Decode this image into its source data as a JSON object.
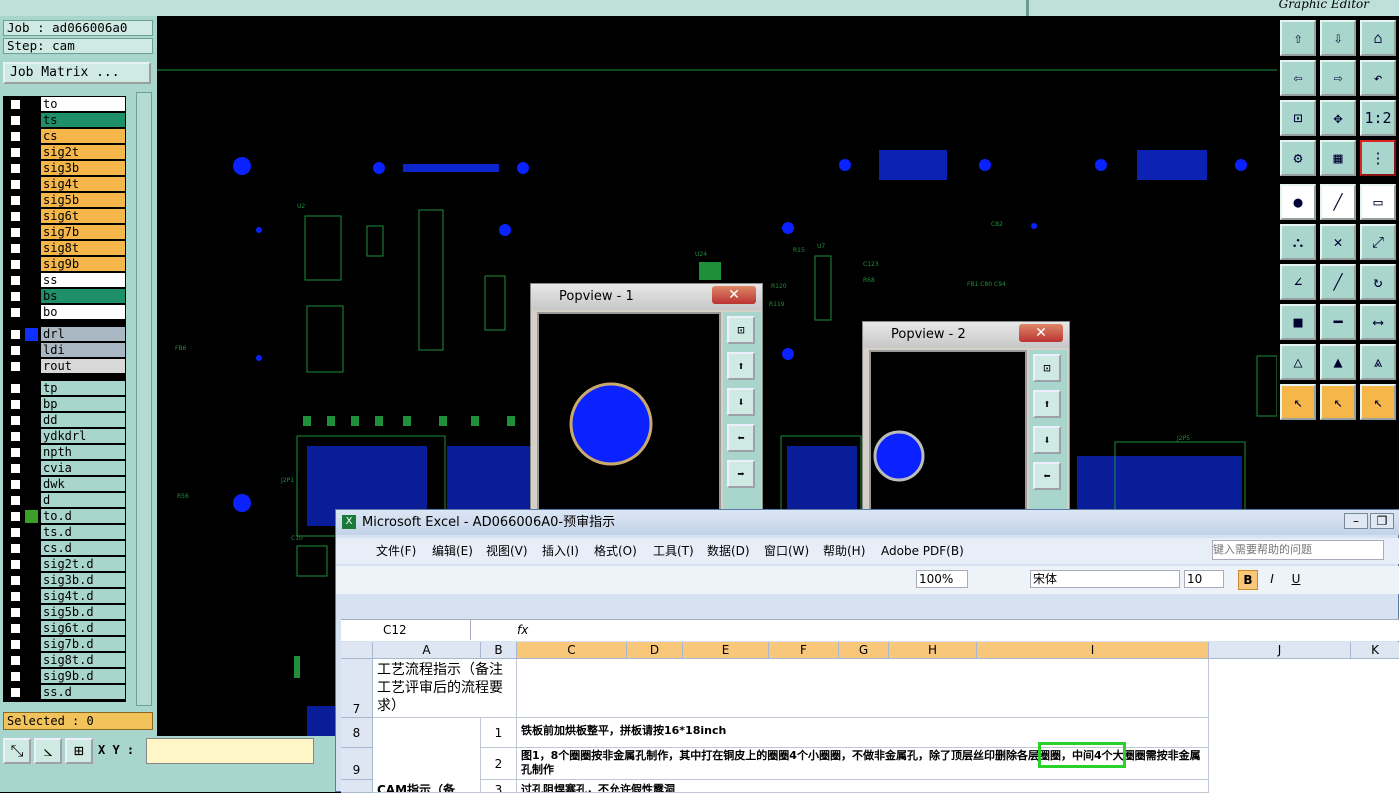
{
  "app": {
    "title": "Graphic Editor"
  },
  "job": {
    "name": "Job : ad066006a0",
    "step": "Step: cam",
    "matrix_label": "Job Matrix ..."
  },
  "layers": [
    {
      "name": "to",
      "color": "#ffffff"
    },
    {
      "name": "ts",
      "color": "#1f8f6a"
    },
    {
      "name": "cs",
      "color": "#f5b74a"
    },
    {
      "name": "sig2t",
      "color": "#f5b74a"
    },
    {
      "name": "sig3b",
      "color": "#f5b74a"
    },
    {
      "name": "sig4t",
      "color": "#f5b74a"
    },
    {
      "name": "sig5b",
      "color": "#f5b74a"
    },
    {
      "name": "sig6t",
      "color": "#f5b74a"
    },
    {
      "name": "sig7b",
      "color": "#f5b74a"
    },
    {
      "name": "sig8t",
      "color": "#f5b74a"
    },
    {
      "name": "sig9b",
      "color": "#f5b74a"
    },
    {
      "name": "ss",
      "color": "#ffffff"
    },
    {
      "name": "bs",
      "color": "#1f8f6a"
    },
    {
      "name": "bo",
      "color": "#ffffff"
    }
  ],
  "drill_layers": [
    {
      "name": "drl",
      "color": "#aab8c4"
    },
    {
      "name": "ldi",
      "color": "#aab8c4"
    },
    {
      "name": "rout",
      "color": "#d8d8d8"
    }
  ],
  "other_layers": [
    "tp",
    "bp",
    "dd",
    "ydkdrl",
    "npth",
    "cvia",
    "dwk",
    "d",
    "to.d",
    "ts.d",
    "cs.d",
    "sig2t.d",
    "sig3b.d",
    "sig4t.d",
    "sig5b.d",
    "sig6t.d",
    "sig7b.d",
    "sig8t.d",
    "sig9b.d",
    "ss.d"
  ],
  "status": {
    "selected": "Selected : 0",
    "xy_label": "X Y :"
  },
  "popviews": [
    {
      "title": "Popview - 1"
    },
    {
      "title": "Popview - 2"
    }
  ],
  "excel": {
    "title": "Microsoft Excel - AD066006A0-预审指示",
    "menu": [
      "文件(F)",
      "编辑(E)",
      "视图(V)",
      "插入(I)",
      "格式(O)",
      "工具(T)",
      "数据(D)",
      "窗口(W)",
      "帮助(H)",
      "Adobe PDF(B)"
    ],
    "help_placeholder": "键入需要帮助的问题",
    "zoom": "100%",
    "font": "宋体",
    "font_size": "10",
    "name_box": "C12",
    "fx": "fx",
    "columns": [
      "A",
      "B",
      "C",
      "D",
      "E",
      "F",
      "G",
      "H",
      "I",
      "J",
      "K"
    ],
    "rows": [
      {
        "num": "7",
        "a": "工艺流程指示（备注工艺评审后的流程要求）",
        "b": "",
        "c": ""
      },
      {
        "num": "8",
        "a": "",
        "b": "1",
        "c": "铁板前加烘板整平，拼板请按16*18inch"
      },
      {
        "num": "9",
        "a": "",
        "b": "2",
        "c": "图1，8个圈圈按非金属孔制作，其中打在铜皮上的圈圈4个小圈圈，不做非金属孔，除了顶层丝印删除各层圈圈，中间4个大圈圈需按非金属孔制作"
      },
      {
        "num": "",
        "a": "CAM指示（备",
        "b": "3",
        "c": "过孔阻焊塞孔，不允许假性露洞"
      }
    ]
  }
}
